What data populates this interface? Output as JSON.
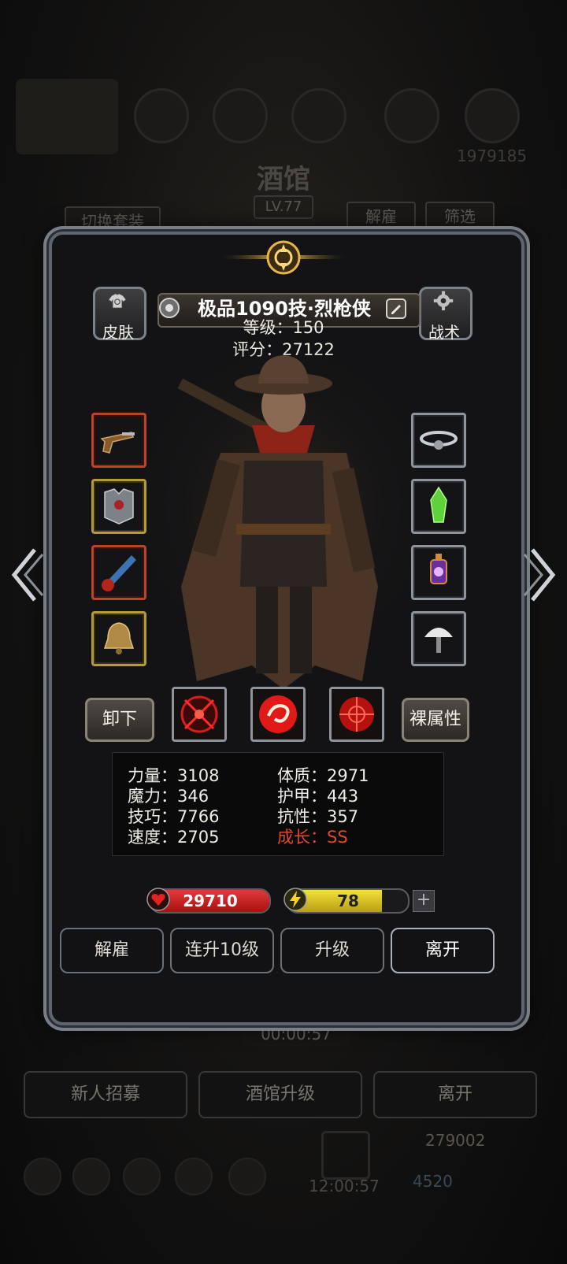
{
  "background": {
    "title": "酒馆",
    "level": "LV.77",
    "switch_outfit": "切换套装",
    "dismiss": "解雇",
    "filter": "筛选",
    "top_right_number": "1979185",
    "timer": "00:00:57",
    "recruit": "新人招募",
    "tavern_upgrade": "酒馆升级",
    "leave": "离开",
    "gem_count": "279002",
    "bottom_timer": "12:00:57",
    "bottom_count": "4520"
  },
  "hero": {
    "name": "极品1090技·烈枪侠",
    "level_line": "等级：150",
    "score_line": "评分：27122",
    "skin_label": "皮肤",
    "tactics_label": "战术"
  },
  "equipment": {
    "left": [
      {
        "name": "flintlock-pistol",
        "frame": "red"
      },
      {
        "name": "plate-armor",
        "frame": "gold"
      },
      {
        "name": "blue-horn",
        "frame": "red"
      },
      {
        "name": "bell",
        "frame": "gold"
      }
    ],
    "right": [
      {
        "name": "cloud-charm",
        "frame": "silver"
      },
      {
        "name": "green-crystal",
        "frame": "silver"
      },
      {
        "name": "purple-lantern",
        "frame": "silver"
      },
      {
        "name": "white-tree",
        "frame": "silver"
      }
    ]
  },
  "actions": {
    "unequip": "卸下",
    "base_attributes": "裸属性"
  },
  "stats": {
    "strength": "力量：3108",
    "magic": "魔力：346",
    "skill": "技巧：7766",
    "speed": "速度：2705",
    "constitution": "体质：2971",
    "armor": "护甲：443",
    "resistance": "抗性：357",
    "growth": "成长：SS"
  },
  "bars": {
    "hp": "29710",
    "energy": "78",
    "energy_fraction": 0.78,
    "plus": "+"
  },
  "buttons": {
    "dismiss": "解雇",
    "level_up_10": "连升10级",
    "level_up": "升级",
    "leave": "离开"
  },
  "colors": {
    "hp_bar": "#c4161b",
    "energy_bar": "#d8c21e",
    "growth_highlight": "#e2472f"
  }
}
